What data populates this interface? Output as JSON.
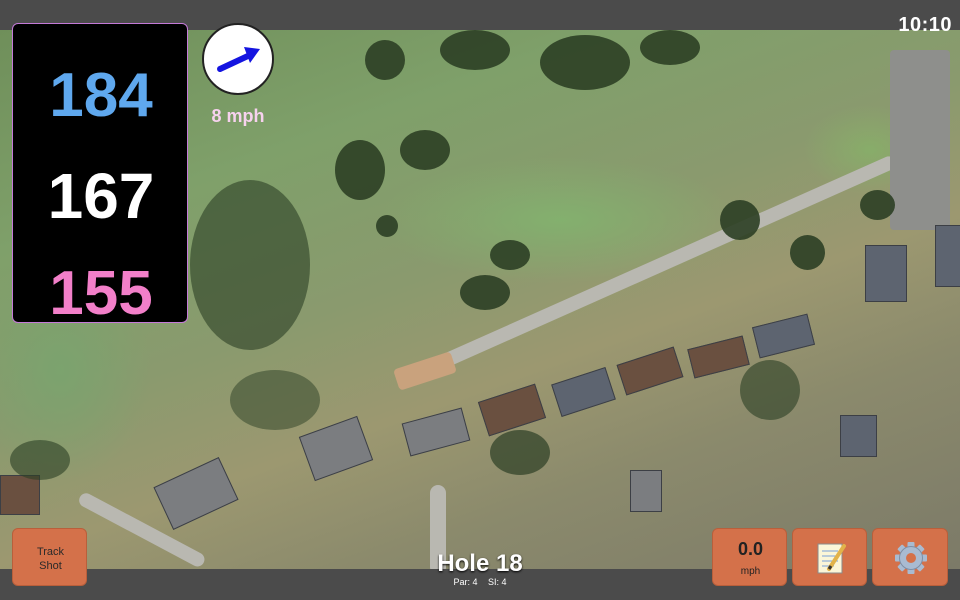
{
  "status": {
    "time": "10:10"
  },
  "distances": {
    "back": "184",
    "middle": "167",
    "front": "155"
  },
  "wind": {
    "speed_label": "8 mph",
    "direction_icon": "wind-arrow-icon"
  },
  "hole": {
    "title": "Hole 18",
    "par": "Par: 4",
    "stroke_index": "SI: 4"
  },
  "buttons": {
    "track_line1": "Track",
    "track_line2": "Shot",
    "wind_value": "0.0",
    "wind_unit": "mph",
    "notes_icon": "notepad-icon",
    "settings_icon": "gear-icon"
  },
  "colors": {
    "back_distance": "#5fa8ee",
    "middle_distance": "#ffffff",
    "front_distance": "#f27fc9",
    "button_bg": "#d4714a",
    "wind_arrow": "#1414e0"
  }
}
